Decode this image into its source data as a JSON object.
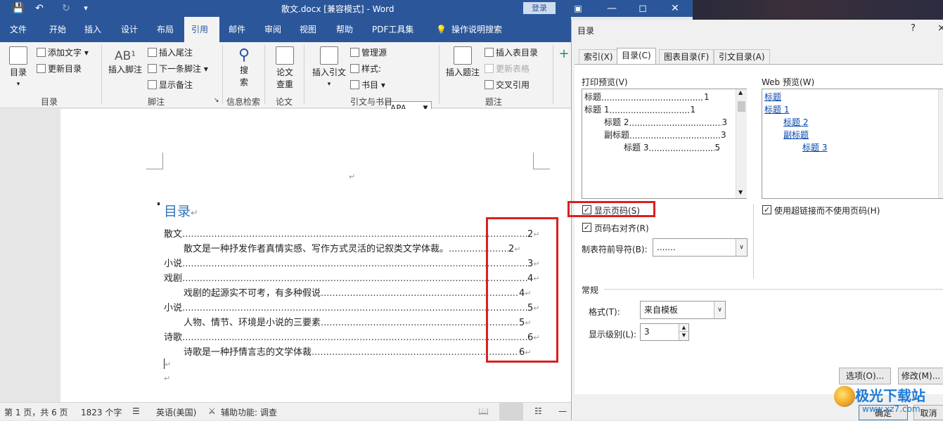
{
  "titlebar": {
    "save_icon": "save-icon",
    "undo_icon": "undo-icon",
    "redo_icon": "redo-icon",
    "title": "散文.docx [兼容模式] - Word",
    "login_label": "登录"
  },
  "menu": {
    "tabs": [
      "文件",
      "开始",
      "插入",
      "设计",
      "布局",
      "引用",
      "邮件",
      "审阅",
      "视图",
      "帮助",
      "PDF工具集",
      "操作说明搜索"
    ],
    "active": "引用"
  },
  "ribbon": {
    "toc": {
      "big": "目录",
      "add_text": "添加文字",
      "update": "更新目录",
      "group": "目录"
    },
    "footnote": {
      "insert_footnote": "插入脚注",
      "insert_endnote": "插入尾注",
      "next_footnote": "下一条脚注",
      "show_notes": "显示备注",
      "group": "脚注"
    },
    "research": {
      "search": "搜\n索",
      "group": "信息检索"
    },
    "paper": {
      "check": "论文\n查重",
      "group": "论文"
    },
    "citation": {
      "insert": "插入引文",
      "manage": "管理源",
      "style_label": "样式:",
      "style_value": "APA",
      "bibliography": "书目",
      "group": "引文与书目"
    },
    "caption": {
      "insert": "插入题注",
      "insert_table": "插入表目录",
      "update_table": "更新表格",
      "cross_ref": "交叉引用",
      "group": "题注"
    }
  },
  "document": {
    "toc_title": "目录",
    "entries": [
      {
        "text": "散文",
        "page": "2"
      },
      {
        "text": "散文是一种抒发作者真情实感、写作方式灵活的记叙类文学体裁。",
        "page": "2"
      },
      {
        "text": "小说",
        "page": "3"
      },
      {
        "text": "戏剧",
        "page": "4"
      },
      {
        "text": "戏剧的起源实不可考，有多种假说",
        "page": "4"
      },
      {
        "text": "小说",
        "page": "5"
      },
      {
        "text": "人物、情节、环境是小说的三要素",
        "page": "5"
      },
      {
        "text": "诗歌",
        "page": "6"
      },
      {
        "text": "诗歌是一种抒情言志的文学体裁",
        "page": "6"
      }
    ],
    "para_mark": "↵"
  },
  "statusbar": {
    "page": "第 1 页，共 6 页",
    "words": "1823 个字",
    "language": "英语(美国)",
    "accessibility": "辅助功能: 调查"
  },
  "dialog": {
    "title": "目录",
    "help": "?",
    "close": "×",
    "tabs": [
      "索引(X)",
      "目录(C)",
      "图表目录(F)",
      "引文目录(A)"
    ],
    "active_tab": "目录(C)",
    "print_preview_label": "打印预览(V)",
    "print_preview": [
      {
        "text": "标题",
        "page": "1"
      },
      {
        "text": "标题  1",
        "page": "1"
      },
      {
        "text": "标题  2",
        "page": "3"
      },
      {
        "text": "副标题",
        "page": "3"
      },
      {
        "text": "标题  3",
        "page": "5"
      }
    ],
    "web_preview_label": "Web 预览(W)",
    "web_preview": [
      "标题",
      "标题  1",
      "标题  2",
      "副标题",
      "标题  3"
    ],
    "show_page_numbers": "显示页码(S)",
    "right_align": "页码右对齐(R)",
    "use_hyperlinks": "使用超链接而不使用页码(H)",
    "tab_leader_label": "制表符前导符(B):",
    "tab_leader_value": ".......",
    "general_label": "常规",
    "format_label": "格式(T):",
    "format_value": "来自模板",
    "levels_label": "显示级别(L):",
    "levels_value": "3",
    "options_button": "选项(O)...",
    "modify_button": "修改(M)...",
    "ok_button": "确定",
    "cancel_button": "取消"
  },
  "watermark": {
    "line1": "极光下载站",
    "line2": "www.xz7.com"
  }
}
